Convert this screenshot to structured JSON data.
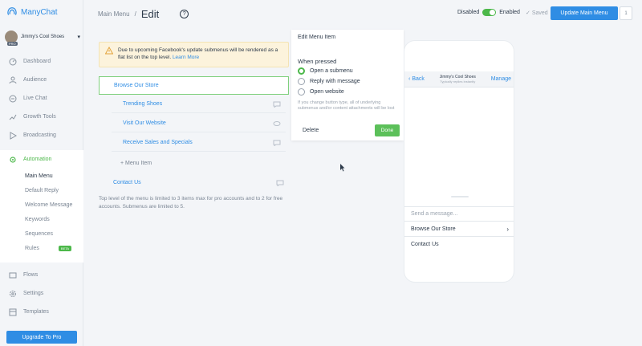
{
  "app": {
    "name": "ManyChat"
  },
  "account": {
    "name": "Jimmy's Cool Shoes",
    "badge": "PRO"
  },
  "sidebar": {
    "items": [
      {
        "label": "Dashboard",
        "icon": "dashboard-icon"
      },
      {
        "label": "Audience",
        "icon": "audience-icon"
      },
      {
        "label": "Live Chat",
        "icon": "chat-icon"
      },
      {
        "label": "Growth Tools",
        "icon": "growth-tools-icon"
      },
      {
        "label": "Broadcasting",
        "icon": "broadcast-icon"
      },
      {
        "label": "Automation",
        "icon": "automation-icon"
      },
      {
        "label": "Flows",
        "icon": "flows-icon"
      },
      {
        "label": "Settings",
        "icon": "settings-icon"
      },
      {
        "label": "Templates",
        "icon": "templates-icon"
      }
    ],
    "automation_sub": [
      {
        "label": "Main Menu"
      },
      {
        "label": "Default Reply"
      },
      {
        "label": "Welcome Message"
      },
      {
        "label": "Keywords"
      },
      {
        "label": "Sequences"
      },
      {
        "label": "Rules",
        "badge": "BETA"
      }
    ],
    "upgrade_label": "Upgrade To Pro"
  },
  "header": {
    "breadcrumb_parent": "Main Menu",
    "breadcrumb_current": "Edit",
    "help": "?",
    "disabled_label": "Disabled",
    "enabled_label": "Enabled",
    "saved_label": "Saved",
    "update_label": "Update Main Menu",
    "counter": "1"
  },
  "notice": {
    "text": "Due to upcoming Facebook's update submenus will be rendered as a flat list on the top level.",
    "link": "Learn More"
  },
  "menu": {
    "root_item": "Browse Our Store",
    "sub_items": [
      "Trending Shoes",
      "Visit Our Website",
      "Receive Sales and Specials"
    ],
    "add_label": "+ Menu Item",
    "second_root": "Contact Us",
    "hint": "Top level of the menu is limited to 3 items max for pro accounts and to 2 for free accounts. Submenus are limited to 5."
  },
  "edit_panel": {
    "title": "Edit Menu Item",
    "when_pressed": "When pressed",
    "options": [
      "Open a submenu",
      "Reply with message",
      "Open website"
    ],
    "selected_option": "Open a submenu",
    "note": "If you change button type, all of underlying submenus and/or content attachments will be lost",
    "delete_label": "Delete",
    "done_label": "Done"
  },
  "preview": {
    "back_label": "Back",
    "page_name": "Jimmy's Cool Shoes",
    "page_subtitle": "Typically replies instantly",
    "manage_label": "Manage",
    "input_placeholder": "Send a message...",
    "menu_items": [
      "Browse Our Store",
      "Contact Us"
    ]
  },
  "colors": {
    "accent": "#2f8de4",
    "success": "#4cb84a",
    "notice_bg": "#fcf3dc"
  }
}
